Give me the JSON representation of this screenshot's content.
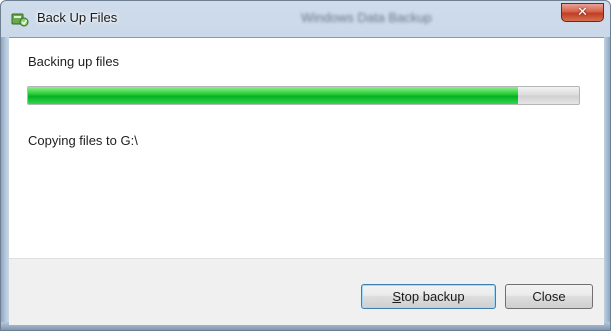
{
  "window": {
    "title": "Back Up Files",
    "blurred_title": "Windows Data Backup",
    "icon": "backup-app-icon",
    "close_icon": "close-icon"
  },
  "content": {
    "heading": "Backing up files",
    "progress": {
      "percent": 89,
      "color": "#06b025"
    },
    "status": "Copying files to G:\\"
  },
  "buttons": {
    "stop_first_letter": "S",
    "stop_rest": "top backup",
    "close": "Close"
  }
}
